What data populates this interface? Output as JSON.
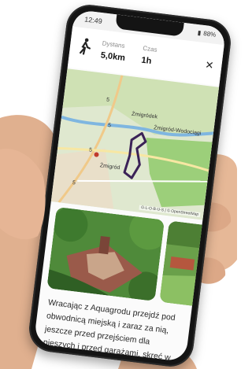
{
  "status": {
    "time": "12:49",
    "battery": "88%"
  },
  "header": {
    "distance_label": "Dystans",
    "distance_value": "5,0km",
    "time_label": "Czas",
    "time_value": "1h"
  },
  "map": {
    "places": [
      "Żmigródek",
      "Żmigród-Wodociągi",
      "Żmigród"
    ],
    "road_labels": [
      "5",
      "5",
      "5",
      "5"
    ],
    "attribution": "G-L-O-B-U-S | © OpenStreetMap"
  },
  "description": "Wracając z Aquagrodu przejdź pod obwodnicą miejską i zaraz za nią, jeszcze przed przejściem dla pieszych i przed garażami, skręć w prawo na ścieżkę rowerową.",
  "colors": {
    "route": "#3b2257",
    "river": "#7fb6e0",
    "park": "#9ccf7a"
  }
}
